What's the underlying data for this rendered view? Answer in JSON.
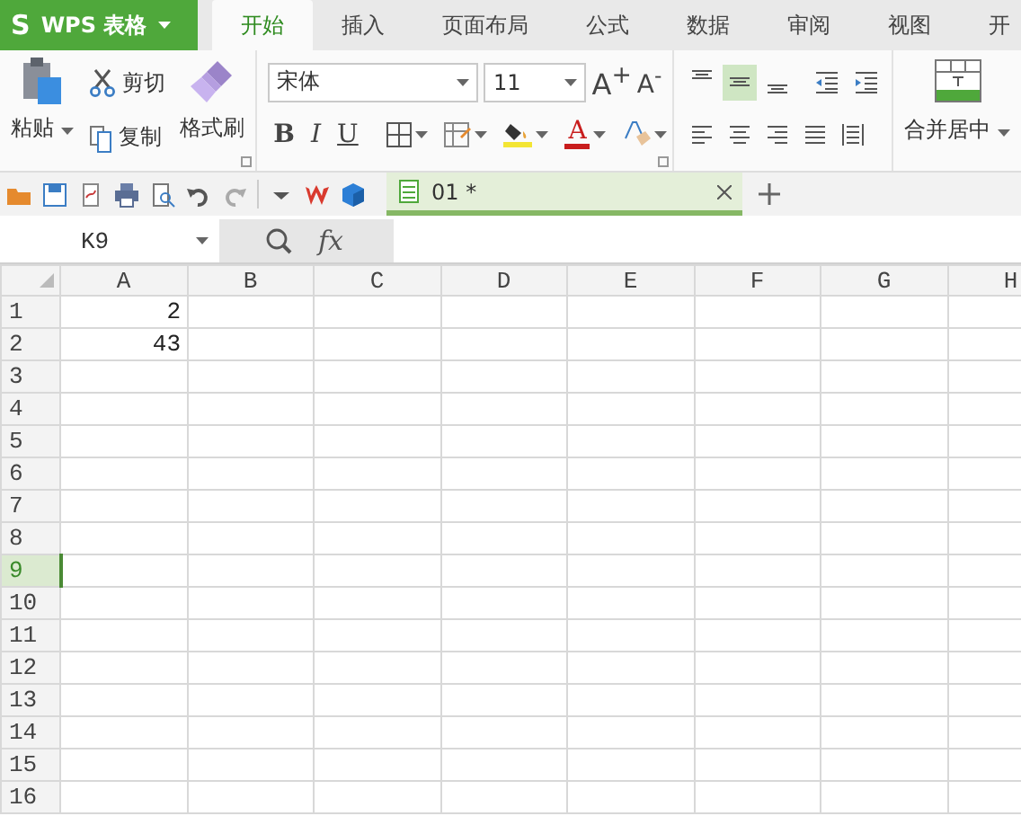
{
  "app_menu": {
    "logo": "S",
    "label": "WPS 表格"
  },
  "tabs": [
    {
      "label": "开始",
      "selected": true
    },
    {
      "label": "插入",
      "selected": false
    },
    {
      "label": "页面布局",
      "selected": false
    },
    {
      "label": "公式",
      "selected": false
    },
    {
      "label": "数据",
      "selected": false
    },
    {
      "label": "审阅",
      "selected": false
    },
    {
      "label": "视图",
      "selected": false
    },
    {
      "label": "开",
      "selected": false
    }
  ],
  "clipboard": {
    "paste": "粘贴",
    "cut": "剪切",
    "copy": "复制",
    "format_painter": "格式刷"
  },
  "font": {
    "name": "宋体",
    "size": "11",
    "grow": "A$^{+}$",
    "shrink": "A$^{-}$",
    "bold": "B",
    "italic": "I",
    "underline": "U",
    "font_color": "A"
  },
  "alignment": {
    "vertical": [
      {
        "kind": "top",
        "selected": false
      },
      {
        "kind": "middle",
        "selected": true
      },
      {
        "kind": "bottom",
        "selected": false
      }
    ],
    "indent": [
      {
        "kind": "decrease"
      },
      {
        "kind": "increase"
      }
    ],
    "horizontal": [
      {
        "kind": "left",
        "selected": false
      },
      {
        "kind": "center",
        "selected": false
      },
      {
        "kind": "right",
        "selected": false
      },
      {
        "kind": "justify",
        "selected": false
      },
      {
        "kind": "distributed",
        "selected": false
      }
    ]
  },
  "merge": {
    "label": "合并居中"
  },
  "document_tabs": [
    {
      "label": "01 *",
      "selected": true
    }
  ],
  "formula_bar": {
    "name_box": "K9",
    "fx": "fx"
  },
  "sheet": {
    "columns": [
      "A",
      "B",
      "C",
      "D",
      "E",
      "F",
      "G",
      "H"
    ],
    "rows": [
      {
        "header": "1",
        "selected": false,
        "cells": [
          "2"
        ]
      },
      {
        "header": "2",
        "selected": false,
        "cells": [
          "43"
        ]
      },
      {
        "header": "3",
        "selected": false
      },
      {
        "header": "4",
        "selected": false
      },
      {
        "header": "5",
        "selected": false
      },
      {
        "header": "6",
        "selected": false
      },
      {
        "header": "7",
        "selected": false
      },
      {
        "header": "8",
        "selected": false
      },
      {
        "header": "9",
        "selected": true
      },
      {
        "header": "10",
        "selected": false
      },
      {
        "header": "11",
        "selected": false
      },
      {
        "header": "12",
        "selected": false
      },
      {
        "header": "13",
        "selected": false
      },
      {
        "header": "14",
        "selected": false
      },
      {
        "header": "15",
        "selected": false
      },
      {
        "header": "16",
        "selected": false
      }
    ]
  }
}
